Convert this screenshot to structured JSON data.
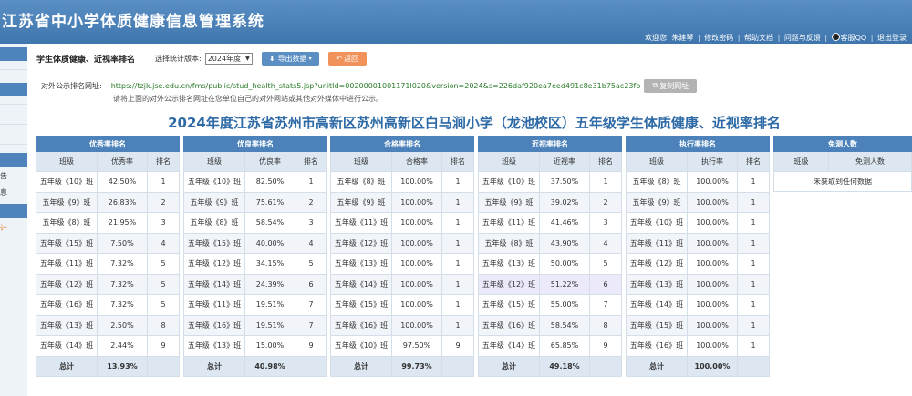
{
  "header": {
    "title": "江苏省中小学体质健康信息管理系统",
    "welcome": "欢迎您: 朱建琴",
    "links": [
      "修改密码",
      "帮助文档",
      "问题与反馈",
      "客服QQ",
      "退出登录"
    ]
  },
  "sidebar": {
    "labels": [
      "告",
      "息",
      "计"
    ]
  },
  "toolbar": {
    "page_title": "学生体质健康、近视率排名",
    "version_label": "选择统计版本:",
    "version_value": "2024年度",
    "export_label": "导出数据",
    "back_label": "返回"
  },
  "public_url": {
    "label": "对外公示排名网址:",
    "value": "https://tzjk.jse.edu.cn/fms/public/stud_health_stats5.jsp?unitId=00200001001171l020&version=2024&s=226daf920ea7eed491c8e31b75ac23fb",
    "copy_label": "复制网址",
    "hint": "请将上面的对外公示排名网址在您单位自己的对外网站或其他对外媒体中进行公示。"
  },
  "report_title": "2024年度江苏省苏州市高新区苏州高新区白马涧小学（龙池校区）五年级学生体质健康、近视率排名",
  "tables": [
    {
      "caption": "优秀率排名",
      "headers": [
        "班级",
        "优秀率",
        "排名"
      ],
      "rows": [
        [
          "五年级《10》班",
          "42.50%",
          "1"
        ],
        [
          "五年级《9》班",
          "26.83%",
          "2"
        ],
        [
          "五年级《8》班",
          "21.95%",
          "3"
        ],
        [
          "五年级《15》班",
          "7.50%",
          "4"
        ],
        [
          "五年级《11》班",
          "7.32%",
          "5"
        ],
        [
          "五年级《12》班",
          "7.32%",
          "5"
        ],
        [
          "五年级《16》班",
          "7.32%",
          "5"
        ],
        [
          "五年级《13》班",
          "2.50%",
          "8"
        ],
        [
          "五年级《14》班",
          "2.44%",
          "9"
        ]
      ],
      "total_label": "总计",
      "total_value": "13.93%"
    },
    {
      "caption": "优良率排名",
      "headers": [
        "班级",
        "优良率",
        "排名"
      ],
      "rows": [
        [
          "五年级《10》班",
          "82.50%",
          "1"
        ],
        [
          "五年级《9》班",
          "75.61%",
          "2"
        ],
        [
          "五年级《8》班",
          "58.54%",
          "3"
        ],
        [
          "五年级《15》班",
          "40.00%",
          "4"
        ],
        [
          "五年级《12》班",
          "34.15%",
          "5"
        ],
        [
          "五年级《14》班",
          "24.39%",
          "6"
        ],
        [
          "五年级《11》班",
          "19.51%",
          "7"
        ],
        [
          "五年级《16》班",
          "19.51%",
          "7"
        ],
        [
          "五年级《13》班",
          "15.00%",
          "9"
        ]
      ],
      "total_label": "总计",
      "total_value": "40.98%"
    },
    {
      "caption": "合格率排名",
      "headers": [
        "班级",
        "合格率",
        "排名"
      ],
      "rows": [
        [
          "五年级《8》班",
          "100.00%",
          "1"
        ],
        [
          "五年级《9》班",
          "100.00%",
          "1"
        ],
        [
          "五年级《11》班",
          "100.00%",
          "1"
        ],
        [
          "五年级《12》班",
          "100.00%",
          "1"
        ],
        [
          "五年级《13》班",
          "100.00%",
          "1"
        ],
        [
          "五年级《14》班",
          "100.00%",
          "1"
        ],
        [
          "五年级《15》班",
          "100.00%",
          "1"
        ],
        [
          "五年级《16》班",
          "100.00%",
          "1"
        ],
        [
          "五年级《10》班",
          "97.50%",
          "9"
        ]
      ],
      "total_label": "总计",
      "total_value": "99.73%"
    },
    {
      "caption": "近视率排名",
      "headers": [
        "班级",
        "近视率",
        "排名"
      ],
      "rows": [
        [
          "五年级《10》班",
          "37.50%",
          "1"
        ],
        [
          "五年级《9》班",
          "39.02%",
          "2"
        ],
        [
          "五年级《11》班",
          "41.46%",
          "3"
        ],
        [
          "五年级《8》班",
          "43.90%",
          "4"
        ],
        [
          "五年级《13》班",
          "50.00%",
          "5"
        ],
        [
          "五年级《12》班",
          "51.22%",
          "6"
        ],
        [
          "五年级《15》班",
          "55.00%",
          "7"
        ],
        [
          "五年级《16》班",
          "58.54%",
          "8"
        ],
        [
          "五年级《14》班",
          "65.85%",
          "9"
        ]
      ],
      "total_label": "总计",
      "total_value": "49.18%"
    },
    {
      "caption": "执行率排名",
      "headers": [
        "班级",
        "执行率",
        "排名"
      ],
      "rows": [
        [
          "五年级《8》班",
          "100.00%",
          "1"
        ],
        [
          "五年级《9》班",
          "100.00%",
          "1"
        ],
        [
          "五年级《10》班",
          "100.00%",
          "1"
        ],
        [
          "五年级《11》班",
          "100.00%",
          "1"
        ],
        [
          "五年级《12》班",
          "100.00%",
          "1"
        ],
        [
          "五年级《13》班",
          "100.00%",
          "1"
        ],
        [
          "五年级《14》班",
          "100.00%",
          "1"
        ],
        [
          "五年级《15》班",
          "100.00%",
          "1"
        ],
        [
          "五年级《16》班",
          "100.00%",
          "1"
        ]
      ],
      "total_label": "总计",
      "total_value": "100.00%"
    }
  ],
  "exempt_table": {
    "caption": "免测人数",
    "headers": [
      "班级",
      "免测人数"
    ],
    "empty_text": "未获取到任何数据"
  }
}
